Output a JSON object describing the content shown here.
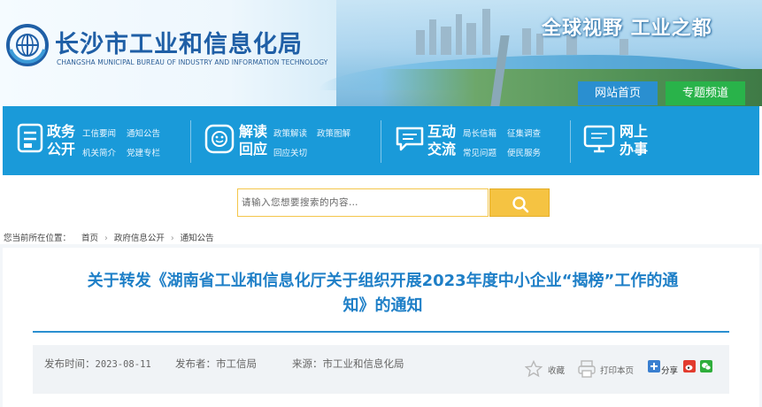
{
  "header": {
    "site_name": "长沙市工业和信息化局",
    "site_name_en": "CHANGSHA MUNICIPAL BUREAU OF INDUSTRY AND INFORMATION TECHNOLOGY",
    "slogan": "全球视野 工业之都",
    "nav": {
      "home": "网站首页",
      "topics": "专题频道"
    }
  },
  "mainnav": {
    "gov": {
      "title_1": "政务",
      "title_2": "公开",
      "links": [
        "工信要闻",
        "通知公告",
        "机关简介",
        "党建专栏"
      ]
    },
    "policy": {
      "title_1": "解读",
      "title_2": "回应",
      "links": [
        "政策解读",
        "政策图解",
        "回应关切"
      ]
    },
    "interact": {
      "title_1": "互动",
      "title_2": "交流",
      "links": [
        "局长信箱",
        "征集调查",
        "常见问题",
        "便民服务"
      ]
    },
    "online": {
      "title_1": "网上",
      "title_2": "办事"
    }
  },
  "search": {
    "placeholder": "请输入您想要搜索的内容…"
  },
  "breadcrumb": {
    "prefix": "您当前所在位置：",
    "items": [
      "首页",
      "政府信息公开",
      "通知公告"
    ]
  },
  "article": {
    "title_line1": "关于转发《湖南省工业和信息化厅关于组织开展2023年度中小企业“揭榜”工作的通",
    "title_line2": "知》的通知",
    "publish_time_label": "发布时间：",
    "publish_time": "2023-08-11",
    "publisher_label": "发布者：",
    "publisher": "市工信局",
    "source_label": "来源：",
    "source": "市工业和信息化局",
    "tools": {
      "favorite": "收藏",
      "print": "打印本页",
      "share": "分享"
    }
  },
  "colors": {
    "brand_blue": "#1a9ad9",
    "title_blue": "#1e7fc7",
    "search_yellow": "#f5c342",
    "topic_green": "#29b34a"
  }
}
